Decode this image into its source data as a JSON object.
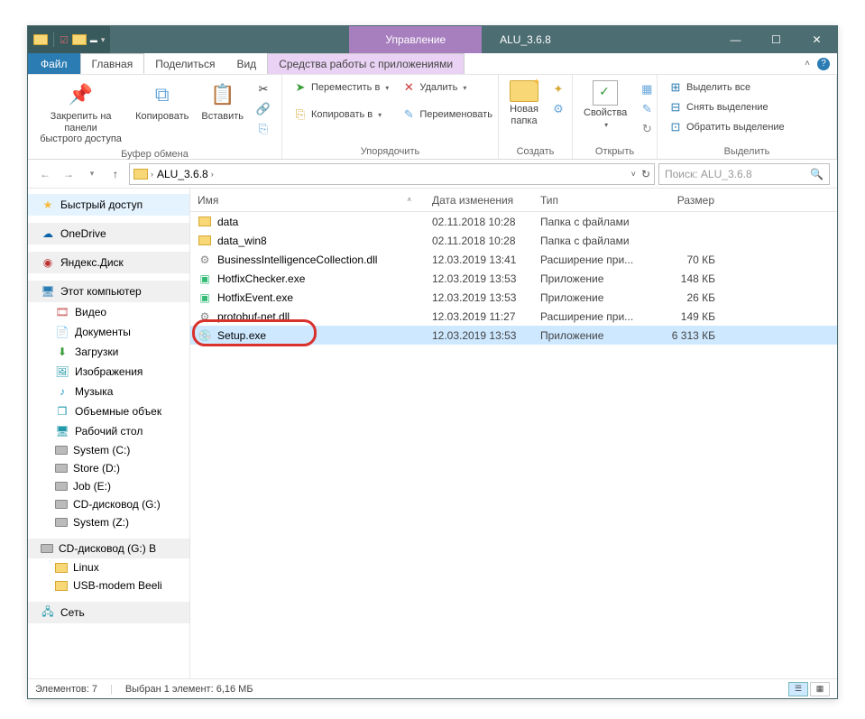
{
  "titlebar": {
    "group_label": "Управление",
    "window_title": "ALU_3.6.8"
  },
  "menu": {
    "file": "Файл",
    "home": "Главная",
    "share": "Поделиться",
    "view": "Вид",
    "tools": "Средства работы с приложениями"
  },
  "ribbon": {
    "pin": "Закрепить на панели\nбыстрого доступа",
    "copy": "Копировать",
    "paste": "Вставить",
    "clipboard_group": "Буфер обмена",
    "move_to": "Переместить в",
    "copy_to": "Копировать в",
    "delete": "Удалить",
    "rename": "Переименовать",
    "organize_group": "Упорядочить",
    "new_folder": "Новая\nпапка",
    "create_group": "Создать",
    "properties": "Свойства",
    "open_group": "Открыть",
    "select_all": "Выделить все",
    "deselect": "Снять выделение",
    "invert": "Обратить выделение",
    "select_group": "Выделить"
  },
  "address": {
    "folder": "ALU_3.6.8",
    "search_placeholder": "Поиск: ALU_3.6.8"
  },
  "sidebar": {
    "quick": "Быстрый доступ",
    "onedrive": "OneDrive",
    "yandex": "Яндекс.Диск",
    "thispc": "Этот компьютер",
    "videos": "Видео",
    "documents": "Документы",
    "downloads": "Загрузки",
    "pictures": "Изображения",
    "music": "Музыка",
    "objects3d": "Объемные объек",
    "desktop": "Рабочий стол",
    "system_c": "System (C:)",
    "store_d": "Store (D:)",
    "job_e": "Job (E:)",
    "cd_g": "CD-дисковод (G:)",
    "system_z": "System (Z:)",
    "cd_g_b": "CD-дисковод (G:) B",
    "linux": "Linux",
    "usb": "USB-modem Beeli",
    "network": "Сеть"
  },
  "columns": {
    "name": "Имя",
    "date": "Дата изменения",
    "type": "Тип",
    "size": "Размер"
  },
  "files": [
    {
      "icon": "folder",
      "name": "data",
      "date": "02.11.2018 10:28",
      "type": "Папка с файлами",
      "size": ""
    },
    {
      "icon": "folder",
      "name": "data_win8",
      "date": "02.11.2018 10:28",
      "type": "Папка с файлами",
      "size": ""
    },
    {
      "icon": "dll",
      "name": "BusinessIntelligenceCollection.dll",
      "date": "12.03.2019 13:41",
      "type": "Расширение при...",
      "size": "70 КБ"
    },
    {
      "icon": "exe",
      "name": "HotfixChecker.exe",
      "date": "12.03.2019 13:53",
      "type": "Приложение",
      "size": "148 КБ"
    },
    {
      "icon": "exe",
      "name": "HotfixEvent.exe",
      "date": "12.03.2019 13:53",
      "type": "Приложение",
      "size": "26 КБ"
    },
    {
      "icon": "dll",
      "name": "protobuf-net.dll",
      "date": "12.03.2019 11:27",
      "type": "Расширение при...",
      "size": "149 КБ"
    },
    {
      "icon": "setup",
      "name": "Setup.exe",
      "date": "12.03.2019 13:53",
      "type": "Приложение",
      "size": "6 313 КБ",
      "selected": true
    }
  ],
  "status": {
    "elements": "Элементов: 7",
    "selection": "Выбран 1 элемент: 6,16 МБ"
  }
}
